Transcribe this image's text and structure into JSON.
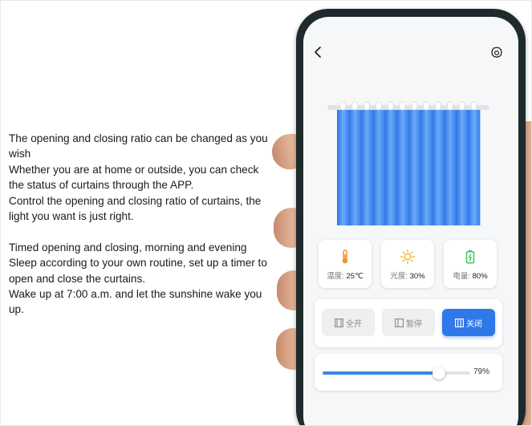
{
  "description": {
    "para1": [
      "The opening and closing ratio can be changed as you wish",
      "Whether you are at home or outside, you can check the status of curtains through the APP.",
      "Control the opening and closing ratio of curtains, the light you want is just right."
    ],
    "para2": [
      "Timed opening and closing, morning and evening Sleep according to your own routine, set up a timer to open and close the curtains.",
      "Wake up at 7:00 a.m. and let the sunshine wake you up."
    ]
  },
  "app": {
    "header": {
      "back_icon": "chevron-left-icon",
      "settings_icon": "gear-icon"
    },
    "curtain": {
      "rail_color": "#e6e6e6",
      "fabric_color": "#3a82ee",
      "fabric_light": "#66a8f7",
      "panels": 12
    },
    "status": {
      "temperature": {
        "label": "温度:",
        "value": "25℃",
        "icon": "thermometer-icon",
        "color": "#f0932b"
      },
      "light": {
        "label": "光度:",
        "value": "30%",
        "icon": "sun-icon",
        "color": "#f5b82e"
      },
      "battery": {
        "label": "电量:",
        "value": "80%",
        "icon": "battery-icon",
        "color": "#3ec45a"
      }
    },
    "controls": {
      "open_all": "全开",
      "pause": "暂停",
      "close": "关闭",
      "active": "close",
      "active_color": "#2f78e8"
    },
    "slider": {
      "value": 79,
      "label": "79%"
    }
  }
}
